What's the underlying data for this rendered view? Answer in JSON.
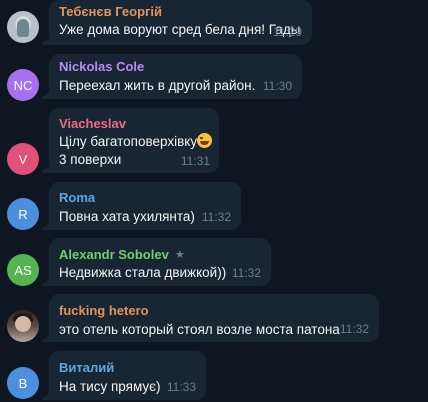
{
  "messages": [
    {
      "sender": "Тебєнєв Георгій",
      "name_color": "#e3935a",
      "avatar_type": "photo",
      "avatar_desc": "person-photo",
      "lines": [
        "Уже дома воруют сред бела дня! Гады"
      ],
      "time": "11:29"
    },
    {
      "sender": "Nickolas Cole",
      "name_color": "#b88bf0",
      "avatar_initials": "NC",
      "avatar_color": "#a770ef",
      "lines": [
        "Переехал жить в другой район."
      ],
      "time": "11:30"
    },
    {
      "sender": "Viacheslav",
      "name_color": "#ee6c88",
      "avatar_initials": "V",
      "avatar_color": "#e0507a",
      "lines": [
        "Цілу багатоповерхівку",
        "3 поверхи"
      ],
      "emoji": "grinning-sweat-emoji",
      "time": "11:31"
    },
    {
      "sender": "Roma",
      "name_color": "#59a8e5",
      "avatar_initials": "R",
      "avatar_color": "#4c8fdc",
      "lines": [
        "Повна хата ухилянта)"
      ],
      "time": "11:32"
    },
    {
      "sender": "Alexandr Sobolev",
      "name_color": "#73cf6c",
      "avatar_initials": "AS",
      "avatar_color": "#56b350",
      "lines": [
        "Недвижка стала движкой))"
      ],
      "badge": "star-icon",
      "time": "11:32"
    },
    {
      "sender": "fucking hetero",
      "name_color": "#e3935a",
      "avatar_type": "photo",
      "avatar_desc": "person-photo",
      "lines": [
        "это отель который стоял возле моста патона"
      ],
      "time": "11:32"
    },
    {
      "sender": "Виталий",
      "name_color": "#59a8e5",
      "avatar_initials": "B",
      "avatar_color": "#4c8fdc",
      "lines": [
        "На тису прямує)"
      ],
      "time": "11:33"
    }
  ],
  "colors": {
    "background": "#0e1621",
    "bubble": "#182533",
    "text": "#f5f5f5",
    "time": "#6b7e91"
  }
}
